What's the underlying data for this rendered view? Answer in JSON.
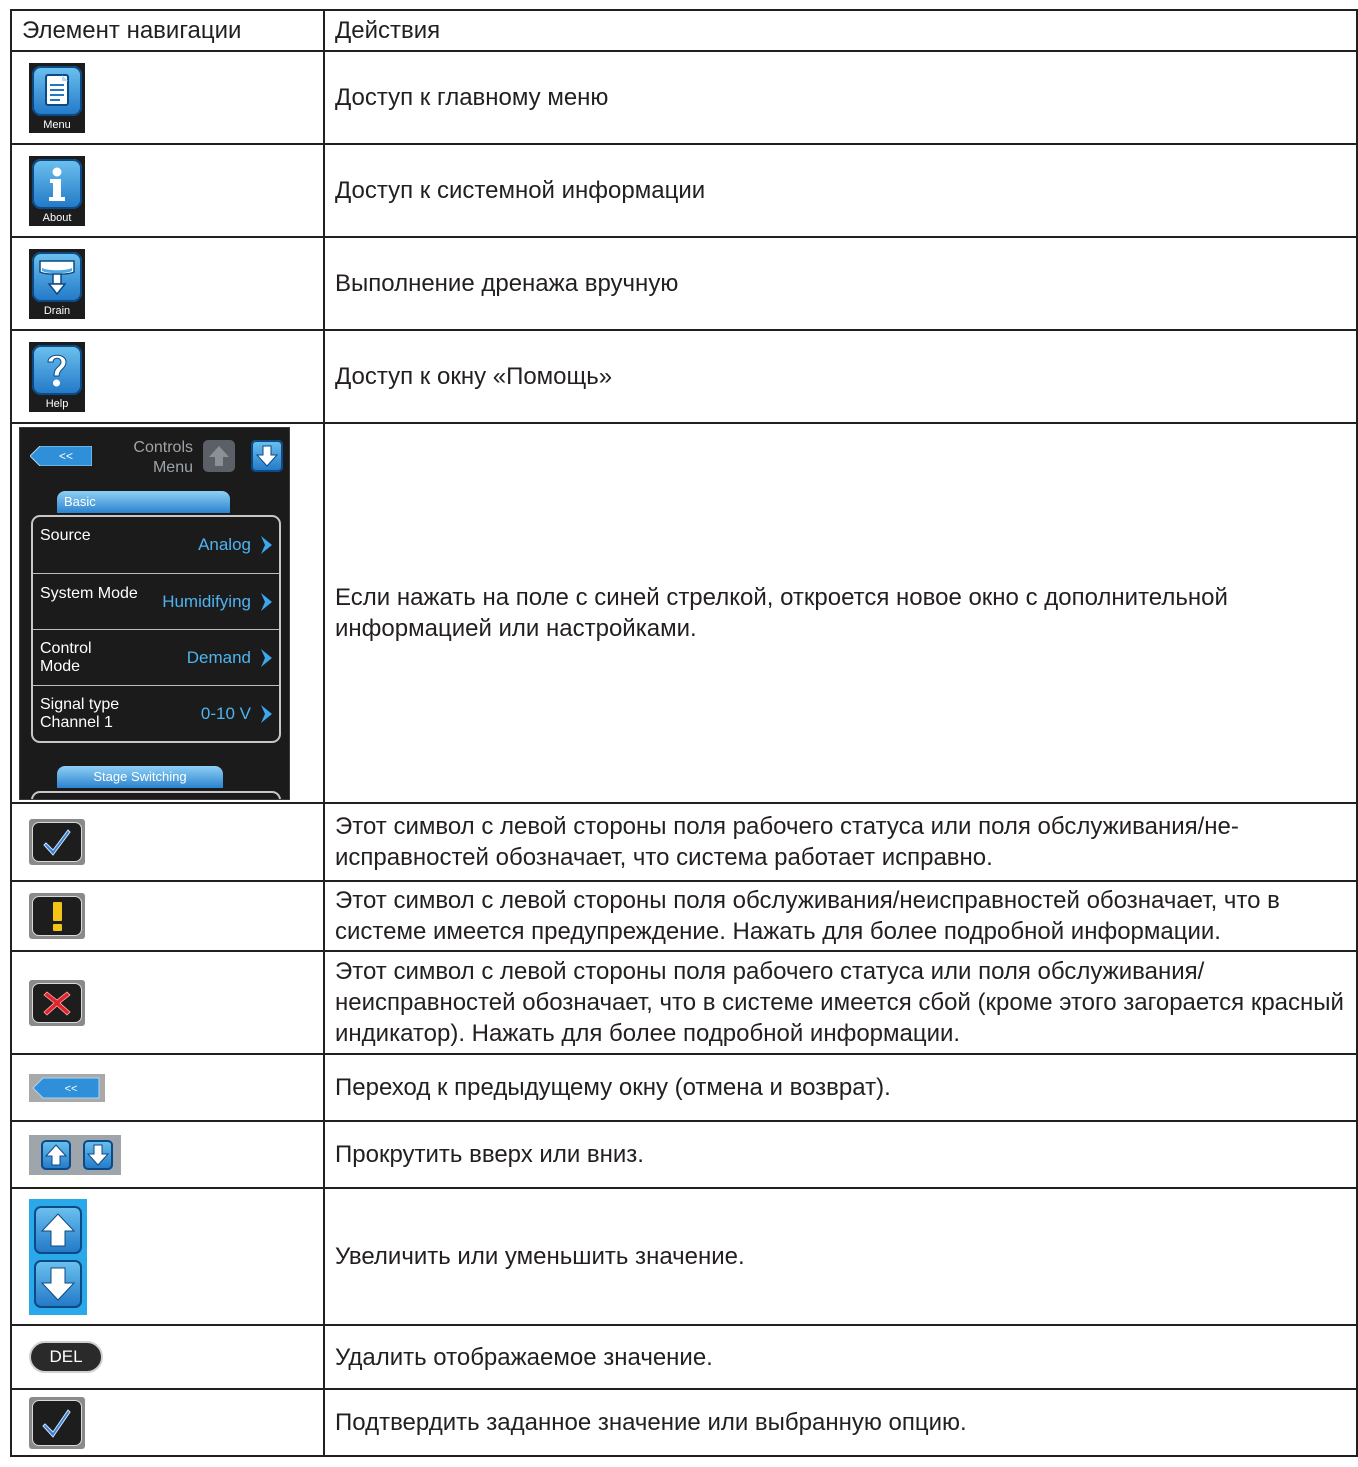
{
  "table": {
    "header": {
      "col1": "Элемент навигации",
      "col2": "Действия"
    },
    "rows": [
      {
        "icon": "menu-icon",
        "caption": "Menu",
        "text": "Доступ к главному меню"
      },
      {
        "icon": "about-info-icon",
        "caption": "About",
        "text": "Доступ к системной информации"
      },
      {
        "icon": "drain-icon",
        "caption": "Drain",
        "text": "Выполнение дренажа вручную"
      },
      {
        "icon": "help-icon",
        "caption": "Help",
        "text": "Доступ к окну «Помощь»"
      },
      {
        "icon": "controls-menu-screen",
        "text": "Если нажать на поле с синей стрелкой, откроется новое окно с дополнительной информацией или настройками."
      },
      {
        "icon": "check-status-icon",
        "text": "Этот символ с левой стороны поля рабочего статуса или поля обслуживания/не-исправностей обозначает, что система работает исправно."
      },
      {
        "icon": "warning-status-icon",
        "text": "Этот символ с левой стороны поля обслуживания/неисправностей обозначает, что в системе имеется предупреждение. Нажать для более подробной информации."
      },
      {
        "icon": "error-status-icon",
        "text": "Этот символ с левой стороны поля рабочего статуса или поля обслуживания/неисправностей обозначает, что в системе имеется сбой (кроме этого загорается красный индикатор). Нажать для более подробной информации."
      },
      {
        "icon": "back-arrow-icon",
        "text": "Переход к предыдущему окну (отмена и возврат)."
      },
      {
        "icon": "scroll-up-down-icon",
        "text": "Прокрутить вверх или вниз."
      },
      {
        "icon": "increase-decrease-icon",
        "text": "Увеличить или уменьшить значение."
      },
      {
        "icon": "delete-button-icon",
        "text": "Удалить отображаемое значение."
      },
      {
        "icon": "confirm-check-icon",
        "text": "Подтвердить заданное значение или выбранную опцию."
      }
    ]
  },
  "screen": {
    "back_label": "<<",
    "title_line1": "Controls",
    "title_line2": "Menu",
    "tab_basic": "Basic",
    "tab_stage": "Stage Switching",
    "items": [
      {
        "label": "Source",
        "value": "Analog"
      },
      {
        "label": "System Mode",
        "value": "Humidifying"
      },
      {
        "label": "Control\nMode",
        "value": "Demand"
      },
      {
        "label": "Signal type\nChannel 1",
        "value": "0-10 V"
      }
    ]
  },
  "small_back_label": "<<",
  "del_label": "DEL",
  "colors": {
    "accent_blue": "#2177c6",
    "value_blue": "#4fb3f0",
    "check_blue": "#3b7fd4",
    "warn_yellow": "#f3c315",
    "error_red": "#e0252b"
  }
}
